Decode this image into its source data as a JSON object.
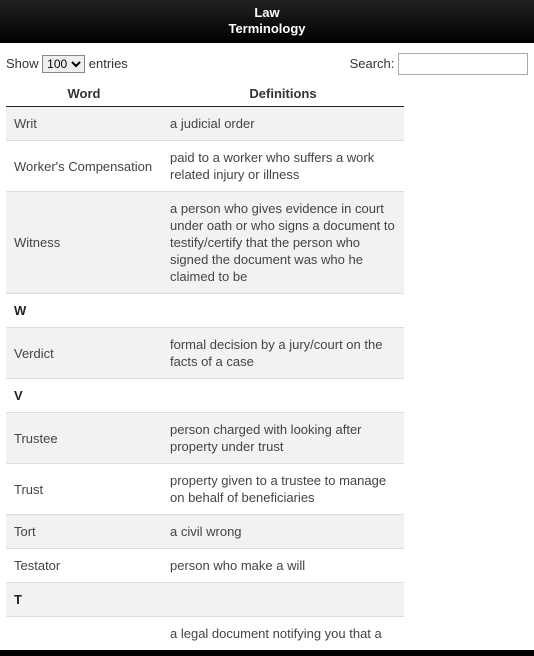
{
  "header": {
    "line1": "Law",
    "line2": "Terminology"
  },
  "toolbar": {
    "show_label": "Show",
    "entries_label": "entries",
    "page_size": "100",
    "search_label": "Search:",
    "search_value": ""
  },
  "columns": {
    "word": "Word",
    "definition": "Definitions"
  },
  "rows": [
    {
      "word": "Writ",
      "definition": "a judicial order",
      "letter": false
    },
    {
      "word": "Worker's Compensation",
      "definition": "paid to a worker who suffers a work related injury or illness",
      "letter": false
    },
    {
      "word": "Witness",
      "definition": "a person who gives evidence in court under oath or who signs a document to testify/certify that the person who signed the document was who he claimed to be",
      "letter": false
    },
    {
      "word": "W",
      "definition": "",
      "letter": true
    },
    {
      "word": "Verdict",
      "definition": "formal decision by a jury/court on the facts of a case",
      "letter": false
    },
    {
      "word": "V",
      "definition": "",
      "letter": true
    },
    {
      "word": "Trustee",
      "definition": "person charged with looking after property under trust",
      "letter": false
    },
    {
      "word": "Trust",
      "definition": "property given to a trustee to manage on behalf of beneficiaries",
      "letter": false
    },
    {
      "word": "Tort",
      "definition": "a civil wrong",
      "letter": false
    },
    {
      "word": "Testator",
      "definition": "person who make a will",
      "letter": false
    },
    {
      "word": "T",
      "definition": "",
      "letter": true
    },
    {
      "word": "",
      "definition": "a legal document notifying you that a",
      "letter": false
    }
  ]
}
